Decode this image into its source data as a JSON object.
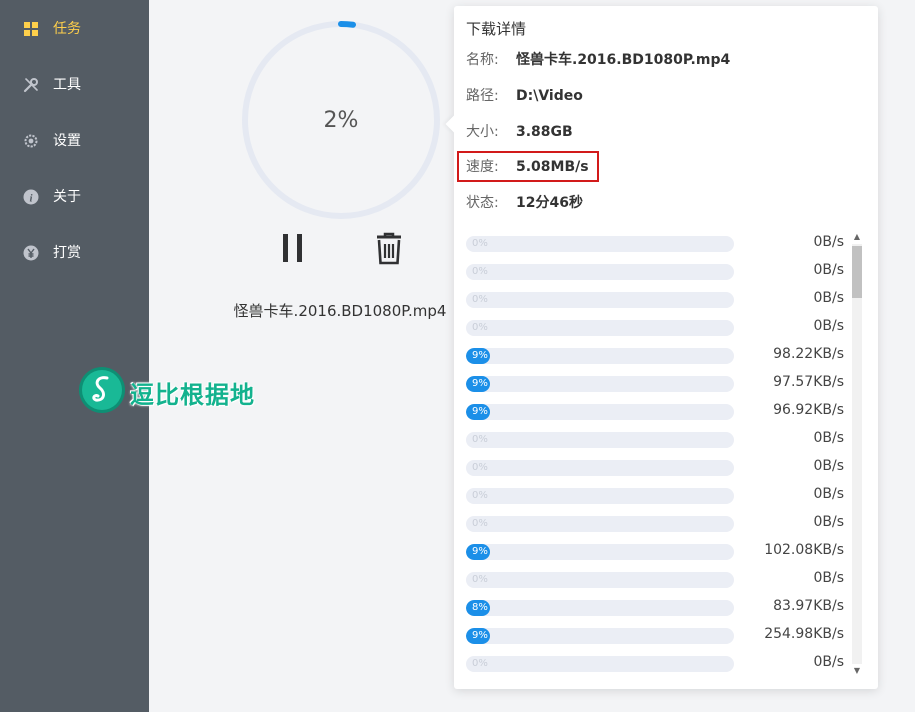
{
  "sidebar": {
    "items": [
      {
        "label": "任务",
        "icon": "grid-icon",
        "active": true
      },
      {
        "label": "工具",
        "icon": "wrench-icon",
        "active": false
      },
      {
        "label": "设置",
        "icon": "gear-icon",
        "active": false
      },
      {
        "label": "关于",
        "icon": "info-icon",
        "active": false
      },
      {
        "label": "打赏",
        "icon": "yen-icon",
        "active": false
      }
    ]
  },
  "task": {
    "progress_label": "2%",
    "progress": 0.02,
    "filename": "怪兽卡车.2016.BD1080P.mp4",
    "pause_icon": "pause-icon",
    "delete_icon": "trash-icon"
  },
  "watermark": {
    "text": "逗比根据地"
  },
  "details": {
    "title": "下载详情",
    "name_key": "名称:",
    "name": "怪兽卡车.2016.BD1080P.mp4",
    "path_key": "路径:",
    "path": "D:\\Video",
    "size_key": "大小:",
    "size": "3.88GB",
    "speed_key": "速度:",
    "speed": "5.08MB/s",
    "status_key": "状态:",
    "status": "12分46秒"
  },
  "segments": [
    {
      "pct": "0%",
      "value": 0,
      "speed": "0B/s"
    },
    {
      "pct": "0%",
      "value": 0,
      "speed": "0B/s"
    },
    {
      "pct": "0%",
      "value": 0,
      "speed": "0B/s"
    },
    {
      "pct": "0%",
      "value": 0,
      "speed": "0B/s"
    },
    {
      "pct": "9%",
      "value": 0.09,
      "speed": "98.22KB/s"
    },
    {
      "pct": "9%",
      "value": 0.09,
      "speed": "97.57KB/s"
    },
    {
      "pct": "9%",
      "value": 0.09,
      "speed": "96.92KB/s"
    },
    {
      "pct": "0%",
      "value": 0,
      "speed": "0B/s"
    },
    {
      "pct": "0%",
      "value": 0,
      "speed": "0B/s"
    },
    {
      "pct": "0%",
      "value": 0,
      "speed": "0B/s"
    },
    {
      "pct": "0%",
      "value": 0,
      "speed": "0B/s"
    },
    {
      "pct": "9%",
      "value": 0.09,
      "speed": "102.08KB/s"
    },
    {
      "pct": "0%",
      "value": 0,
      "speed": "0B/s"
    },
    {
      "pct": "8%",
      "value": 0.08,
      "speed": "83.97KB/s"
    },
    {
      "pct": "9%",
      "value": 0.09,
      "speed": "254.98KB/s"
    },
    {
      "pct": "0%",
      "value": 0,
      "speed": "0B/s"
    }
  ],
  "colors": {
    "sidebar_bg": "#545c64",
    "active": "#ffd04b",
    "accent": "#1b8fe8",
    "highlight_border": "#d21a1a",
    "watermark": "#13b28e"
  }
}
